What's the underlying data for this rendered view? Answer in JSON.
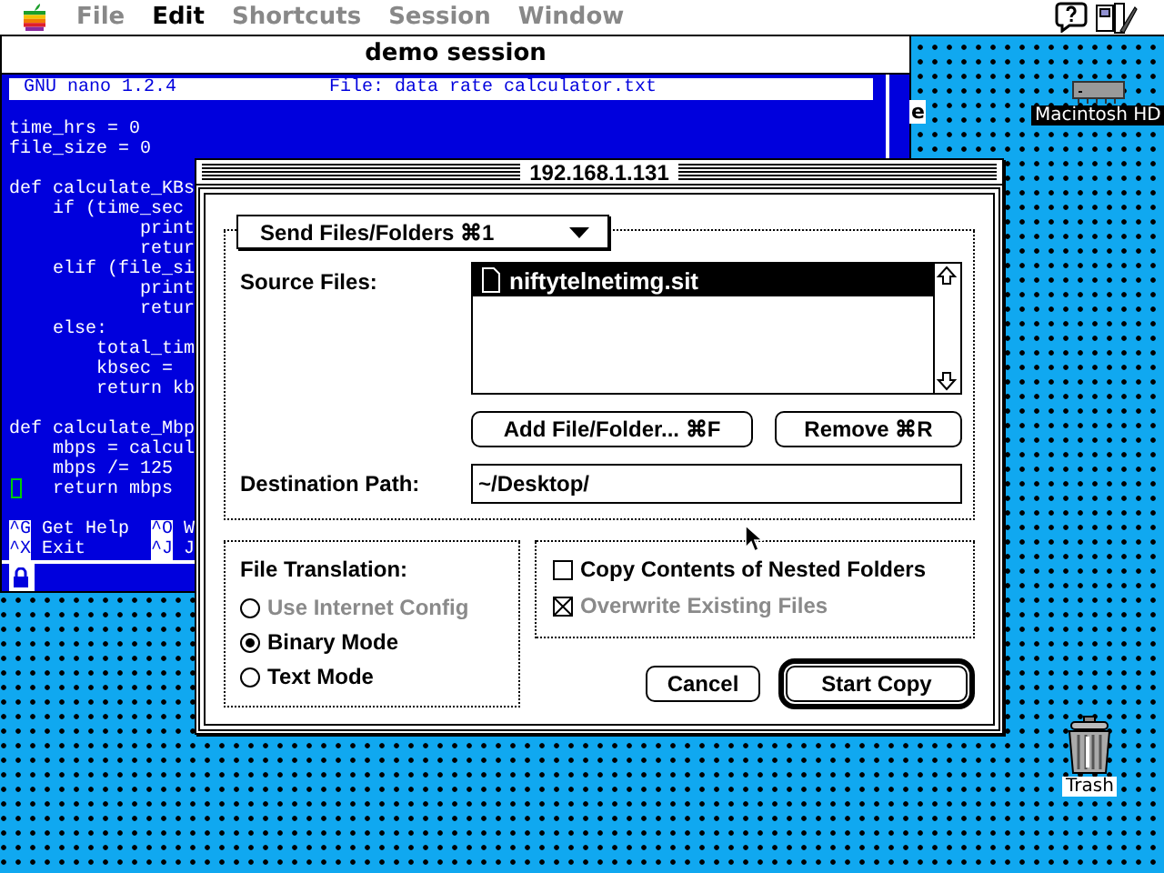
{
  "menu_bar": {
    "items": [
      {
        "label": "File",
        "disabled": true
      },
      {
        "label": "Edit",
        "disabled": false
      },
      {
        "label": "Shortcuts",
        "disabled": true
      },
      {
        "label": "Session",
        "disabled": true
      },
      {
        "label": "Window",
        "disabled": true
      }
    ]
  },
  "terminal": {
    "title": "demo session",
    "header_left": "GNU nano 1.2.4",
    "header_right": "File: data rate calculator.txt",
    "blocks": [
      [
        {
          "text": "time_hrs = 0",
          "cursor": false
        },
        {
          "text": "file_size = 0",
          "cursor": false
        }
      ],
      [
        {
          "text": "def calculate_KBs",
          "cursor": false
        },
        {
          "text": "    if (time_sec",
          "cursor": false
        },
        {
          "text": "            print",
          "cursor": false
        },
        {
          "text": "            retur",
          "cursor": false
        },
        {
          "text": "    elif (file_si",
          "cursor": false
        },
        {
          "text": "            print",
          "cursor": false
        },
        {
          "text": "            retur",
          "cursor": false
        },
        {
          "text": "    else:",
          "cursor": false
        },
        {
          "text": "        total_tim",
          "cursor": false
        },
        {
          "text": "        kbsec =",
          "cursor": false
        },
        {
          "text": "        return kb",
          "cursor": false
        }
      ],
      [
        {
          "text": "def calculate_Mbp",
          "cursor": false
        },
        {
          "text": "    mbps = calcul",
          "cursor": false
        },
        {
          "text": "    mbps /= 125",
          "cursor": false
        },
        {
          "text": "    return mbps",
          "cursor": true
        }
      ]
    ],
    "shortcuts": [
      [
        {
          "key": "^G",
          "label": "Get Help"
        },
        {
          "key": "^O",
          "label": "W"
        }
      ],
      [
        {
          "key": "^X",
          "label": "Exit"
        },
        {
          "key": "^J",
          "label": "J"
        }
      ]
    ]
  },
  "desktop": {
    "partial_label": "e",
    "disk_label": "Macintosh HD",
    "trash_label": "Trash"
  },
  "dialog": {
    "title": "192.168.1.131",
    "mode_popup": "Send Files/Folders ⌘1",
    "source_label": "Source Files:",
    "files": [
      {
        "name": "niftytelnetimg.sit",
        "selected": true
      }
    ],
    "list_buttons": [
      "Add File/Folder... ⌘F",
      "Remove ⌘R"
    ],
    "destination_label": "Destination Path:",
    "destination_value": "~/Desktop/",
    "translation_label": "File Translation:",
    "translation_options": [
      {
        "label": "Use Internet Config",
        "selected": false,
        "disabled": true
      },
      {
        "label": "Binary Mode",
        "selected": true,
        "disabled": false
      },
      {
        "label": "Text Mode",
        "selected": false,
        "disabled": false
      }
    ],
    "options": [
      {
        "label": "Copy Contents of Nested Folders",
        "checked": false,
        "disabled": false
      },
      {
        "label": "Overwrite Existing Files",
        "checked": true,
        "disabled": true
      }
    ],
    "buttons": [
      {
        "label": "Cancel",
        "default": false
      },
      {
        "label": "Start Copy",
        "default": true
      }
    ]
  }
}
